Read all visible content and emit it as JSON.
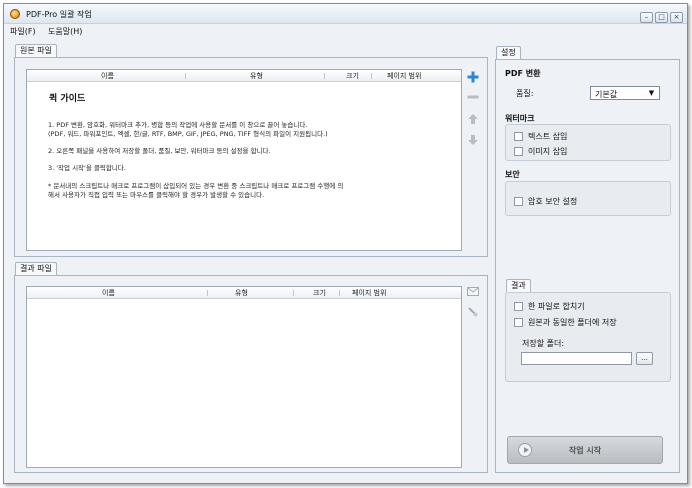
{
  "window": {
    "title": "PDF-Pro 일괄 작업",
    "controls": [
      "minimize",
      "maximize",
      "close"
    ]
  },
  "menu": [
    "파일(F)",
    "도움말(H)"
  ],
  "source": {
    "tab": "원본 파일",
    "columns": [
      "이름",
      "유형",
      "크기",
      "페이지 범위"
    ],
    "guide": {
      "title": "퀵 가이드",
      "lines": [
        "1. PDF 변환, 암호화, 워터마크 추가, 병합 등의 작업에 사용할 문서를 이 창으로 끌어 놓습니다.",
        "(PDF, 워드, 파워포인트, 엑셀, 한/글, RTF, BMP, GIF, JPEG, PNG, TIFF 형식의 파일이 지원됩니다.)",
        "2. 오른쪽 패널을 사용하여 저장할 폴더, 품질, 보안, 워터마크 등의 설정을 합니다.",
        "3. '작업 시작'을 클릭합니다.",
        "* 문서내의 스크립트나 매크로 프로그램이 삽입되어 있는 경우 변환 중 스크립트나 매크로 프로그램 수행에 의",
        "해서 사용자가 직접 입력 또는 마우스를 클릭해야 할 경우가 발생할 수 있습니다."
      ]
    },
    "side_icons": [
      "add-icon",
      "remove-icon",
      "move-up-icon",
      "move-down-icon"
    ]
  },
  "result": {
    "tab": "결과 파일",
    "columns": [
      "이름",
      "유형",
      "크기",
      "페이지 범위"
    ],
    "side_icons": [
      "mail-icon",
      "clear-icon"
    ]
  },
  "settings": {
    "tab": "설정",
    "pdf": {
      "heading": "PDF 변환",
      "quality_label": "품질:",
      "quality_value": "기본값"
    },
    "watermark": {
      "heading": "워터마크",
      "text_option": "텍스트 삽입",
      "image_option": "이미지 삽입"
    },
    "security": {
      "heading": "보안",
      "password_option": "암호 보안 설정"
    },
    "result_group": {
      "tab": "결과",
      "merge_option": "한 파일로 합치기",
      "same_folder_option": "원본과 동일한 폴더에 저장",
      "folder_label": "저장할 폴더:",
      "folder_value": "",
      "browse_label": "..."
    },
    "start_button": "작업 시작"
  },
  "colors": {
    "add": "#2a86d6",
    "disabled_gray": "#9aa3ad",
    "panel_bg": "#eef1f5"
  }
}
